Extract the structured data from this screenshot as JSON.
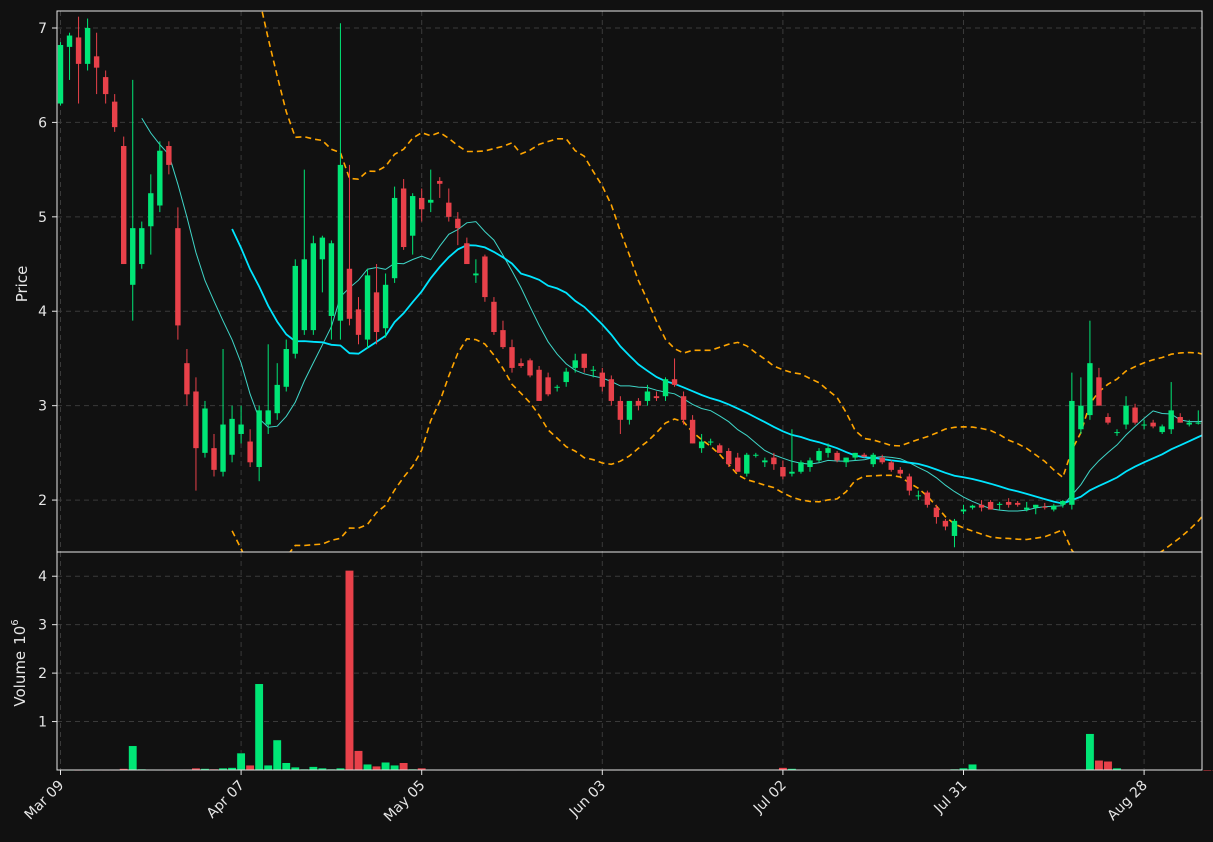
{
  "chart_data": {
    "type": "candlestick",
    "colors": {
      "background": "#111111",
      "up": "#00e676",
      "down": "#e8414a",
      "ma_fast": "#3fd6c8",
      "ma_slow": "#00e5ff",
      "bands": "#ffa500",
      "grid": "#3a3a3a",
      "frame": "#e6e6e6"
    },
    "price_panel": {
      "ylabel": "Price",
      "ylim": [
        1.45,
        7.18
      ],
      "yticks": [
        2,
        3,
        4,
        5,
        6,
        7
      ]
    },
    "volume_panel": {
      "ylabel": "Volume",
      "ylabel_exponent": "10",
      "ylabel_power": "6",
      "ylim": [
        0,
        4.5
      ],
      "yticks": [
        1,
        2,
        3,
        4
      ]
    },
    "x_ticks": [
      {
        "i": 0,
        "label": "Mar 09"
      },
      {
        "i": 20,
        "label": "Apr 07"
      },
      {
        "i": 40,
        "label": "May 05"
      },
      {
        "i": 60,
        "label": "Jun 03"
      },
      {
        "i": 80,
        "label": "Jul 02"
      },
      {
        "i": 100,
        "label": "Jul 31"
      },
      {
        "i": 120,
        "label": "Aug 28"
      }
    ],
    "candles": [
      [
        6.2,
        6.85,
        6.18,
        6.82
      ],
      [
        6.8,
        6.95,
        6.45,
        6.92
      ],
      [
        6.9,
        7.12,
        6.2,
        6.62
      ],
      [
        6.62,
        7.1,
        6.55,
        7.0
      ],
      [
        6.7,
        6.95,
        6.3,
        6.58
      ],
      [
        6.48,
        6.55,
        6.2,
        6.3
      ],
      [
        6.22,
        6.3,
        5.9,
        5.95
      ],
      [
        5.75,
        5.85,
        4.5,
        4.5
      ],
      [
        4.28,
        6.45,
        3.9,
        4.88
      ],
      [
        4.5,
        4.95,
        4.45,
        4.88
      ],
      [
        4.9,
        5.45,
        4.6,
        5.25
      ],
      [
        5.12,
        5.8,
        5.05,
        5.7
      ],
      [
        5.75,
        5.8,
        5.45,
        5.55
      ],
      [
        4.88,
        5.1,
        3.7,
        3.85
      ],
      [
        3.45,
        3.6,
        3.0,
        3.12
      ],
      [
        3.15,
        3.3,
        2.1,
        2.55
      ],
      [
        2.5,
        3.05,
        2.45,
        2.97
      ],
      [
        2.55,
        2.7,
        2.25,
        2.32
      ],
      [
        2.3,
        3.6,
        2.25,
        2.8
      ],
      [
        2.48,
        3.0,
        2.4,
        2.86
      ],
      [
        2.7,
        3.0,
        2.6,
        2.8
      ],
      [
        2.62,
        2.75,
        2.35,
        2.4
      ],
      [
        2.35,
        3.0,
        2.2,
        2.95
      ],
      [
        2.8,
        3.65,
        2.7,
        2.95
      ],
      [
        2.92,
        3.45,
        2.85,
        3.22
      ],
      [
        3.2,
        3.7,
        3.15,
        3.6
      ],
      [
        3.55,
        4.55,
        3.5,
        4.48
      ],
      [
        3.8,
        5.5,
        3.75,
        4.55
      ],
      [
        3.8,
        4.8,
        3.75,
        4.72
      ],
      [
        4.55,
        4.8,
        4.2,
        4.78
      ],
      [
        3.95,
        4.75,
        3.7,
        4.72
      ],
      [
        3.9,
        7.05,
        3.7,
        5.55
      ],
      [
        4.45,
        5.55,
        3.85,
        3.92
      ],
      [
        4.02,
        4.15,
        3.65,
        3.75
      ],
      [
        3.7,
        4.45,
        3.6,
        4.38
      ],
      [
        4.2,
        4.5,
        3.65,
        3.78
      ],
      [
        3.82,
        4.4,
        3.72,
        4.28
      ],
      [
        4.35,
        5.32,
        4.3,
        5.2
      ],
      [
        5.3,
        5.4,
        4.65,
        4.68
      ],
      [
        4.8,
        5.25,
        4.6,
        5.22
      ],
      [
        5.2,
        5.3,
        4.95,
        5.08
      ],
      [
        5.15,
        5.5,
        5.05,
        5.18
      ],
      [
        5.38,
        5.42,
        5.2,
        5.35
      ],
      [
        5.15,
        5.3,
        4.95,
        5.0
      ],
      [
        4.98,
        5.05,
        4.7,
        4.88
      ],
      [
        4.72,
        4.78,
        4.5,
        4.5
      ],
      [
        4.38,
        4.55,
        4.3,
        4.4
      ],
      [
        4.58,
        4.6,
        4.1,
        4.15
      ],
      [
        4.1,
        4.15,
        3.75,
        3.78
      ],
      [
        3.8,
        3.9,
        3.6,
        3.62
      ],
      [
        3.62,
        3.7,
        3.35,
        3.4
      ],
      [
        3.45,
        3.5,
        3.4,
        3.42
      ],
      [
        3.48,
        3.5,
        3.3,
        3.32
      ],
      [
        3.38,
        3.42,
        3.05,
        3.05
      ],
      [
        3.3,
        3.35,
        3.1,
        3.12
      ],
      [
        3.2,
        3.22,
        3.15,
        3.2
      ],
      [
        3.25,
        3.4,
        3.2,
        3.36
      ],
      [
        3.4,
        3.55,
        3.35,
        3.48
      ],
      [
        3.55,
        3.55,
        3.35,
        3.4
      ],
      [
        3.38,
        3.42,
        3.3,
        3.38
      ],
      [
        3.35,
        3.4,
        3.15,
        3.2
      ],
      [
        3.28,
        3.32,
        3.0,
        3.05
      ],
      [
        3.05,
        3.1,
        2.7,
        2.85
      ],
      [
        2.85,
        3.05,
        2.8,
        3.05
      ],
      [
        3.05,
        3.08,
        2.95,
        3.0
      ],
      [
        3.05,
        3.22,
        3.0,
        3.15
      ],
      [
        3.1,
        3.15,
        3.05,
        3.08
      ],
      [
        3.1,
        3.3,
        3.05,
        3.28
      ],
      [
        3.28,
        3.5,
        3.2,
        3.22
      ],
      [
        3.1,
        3.15,
        2.8,
        2.85
      ],
      [
        2.85,
        2.9,
        2.6,
        2.6
      ],
      [
        2.55,
        2.7,
        2.5,
        2.62
      ],
      [
        2.62,
        2.65,
        2.58,
        2.62
      ],
      [
        2.58,
        2.6,
        2.5,
        2.5
      ],
      [
        2.52,
        2.55,
        2.35,
        2.38
      ],
      [
        2.45,
        2.5,
        2.3,
        2.3
      ],
      [
        2.28,
        2.5,
        2.25,
        2.48
      ],
      [
        2.48,
        2.5,
        2.45,
        2.48
      ],
      [
        2.4,
        2.45,
        2.35,
        2.42
      ],
      [
        2.45,
        2.5,
        2.32,
        2.38
      ],
      [
        2.35,
        2.42,
        2.22,
        2.25
      ],
      [
        2.28,
        2.75,
        2.25,
        2.3
      ],
      [
        2.3,
        2.42,
        2.28,
        2.4
      ],
      [
        2.35,
        2.45,
        2.3,
        2.42
      ],
      [
        2.42,
        2.55,
        2.4,
        2.52
      ],
      [
        2.5,
        2.6,
        2.45,
        2.55
      ],
      [
        2.5,
        2.52,
        2.4,
        2.42
      ],
      [
        2.4,
        2.45,
        2.35,
        2.45
      ],
      [
        2.45,
        2.5,
        2.42,
        2.5
      ],
      [
        2.48,
        2.5,
        2.45,
        2.46
      ],
      [
        2.38,
        2.5,
        2.35,
        2.48
      ],
      [
        2.45,
        2.48,
        2.38,
        2.4
      ],
      [
        2.4,
        2.42,
        2.3,
        2.32
      ],
      [
        2.32,
        2.35,
        2.25,
        2.28
      ],
      [
        2.25,
        2.28,
        2.05,
        2.1
      ],
      [
        2.05,
        2.1,
        2.0,
        2.05
      ],
      [
        2.08,
        2.1,
        1.92,
        1.95
      ],
      [
        1.92,
        1.95,
        1.75,
        1.82
      ],
      [
        1.78,
        1.8,
        1.68,
        1.72
      ],
      [
        1.62,
        1.8,
        1.5,
        1.78
      ],
      [
        1.88,
        1.95,
        1.85,
        1.9
      ],
      [
        1.92,
        1.95,
        1.9,
        1.94
      ],
      [
        1.95,
        2.0,
        1.88,
        1.92
      ],
      [
        1.98,
        2.0,
        1.9,
        1.9
      ],
      [
        1.95,
        1.98,
        1.9,
        1.96
      ],
      [
        1.98,
        2.02,
        1.92,
        1.95
      ],
      [
        1.97,
        1.99,
        1.93,
        1.95
      ],
      [
        1.9,
        1.98,
        1.88,
        1.92
      ],
      [
        1.92,
        1.95,
        1.85,
        1.95
      ],
      [
        1.93,
        1.97,
        1.9,
        1.92
      ],
      [
        1.9,
        1.96,
        1.88,
        1.94
      ],
      [
        1.95,
        2.0,
        1.92,
        1.99
      ],
      [
        1.95,
        3.35,
        1.9,
        3.05
      ],
      [
        2.75,
        3.3,
        2.7,
        3.0
      ],
      [
        2.9,
        3.9,
        2.85,
        3.45
      ],
      [
        3.3,
        3.4,
        3.0,
        3.0
      ],
      [
        2.88,
        2.92,
        2.8,
        2.82
      ],
      [
        2.72,
        2.75,
        2.68,
        2.72
      ],
      [
        2.8,
        3.1,
        2.75,
        3.0
      ],
      [
        2.98,
        3.02,
        2.8,
        2.82
      ],
      [
        2.8,
        2.85,
        2.75,
        2.8
      ],
      [
        2.82,
        2.85,
        2.76,
        2.78
      ],
      [
        2.72,
        2.8,
        2.7,
        2.78
      ],
      [
        2.75,
        3.25,
        2.7,
        2.95
      ],
      [
        2.88,
        2.92,
        2.82,
        2.82
      ],
      [
        2.8,
        2.85,
        2.78,
        2.82
      ],
      [
        2.82,
        2.95,
        2.8,
        2.82
      ],
      [
        2.84,
        2.88,
        2.78,
        2.8
      ],
      [
        2.82,
        2.95,
        2.72,
        2.72
      ]
    ],
    "volume": [
      0.005,
      0.004,
      0.003,
      0.004,
      0.004,
      0.004,
      0.004,
      0.03,
      0.5,
      0.02,
      0.015,
      0.01,
      0.008,
      0.01,
      0.012,
      0.04,
      0.03,
      0.02,
      0.04,
      0.05,
      0.35,
      0.1,
      1.78,
      0.1,
      0.62,
      0.15,
      0.06,
      0.02,
      0.07,
      0.04,
      0.02,
      0.04,
      4.12,
      0.4,
      0.12,
      0.08,
      0.16,
      0.1,
      0.15,
      0.02,
      0.04,
      0.015,
      0.01,
      0.01,
      0.01,
      0.01,
      0.005,
      0.005,
      0.005,
      0.005,
      0.01,
      0.005,
      0.01,
      0.005,
      0.005,
      0.005,
      0.005,
      0.01,
      0.005,
      0.005,
      0.005,
      0.01,
      0.005,
      0.01,
      0.005,
      0.005,
      0.01,
      0.005,
      0.01,
      0.005,
      0.005,
      0.005,
      0.005,
      0.005,
      0.01,
      0.005,
      0.005,
      0.005,
      0.005,
      0.01,
      0.05,
      0.03,
      0.01,
      0.005,
      0.005,
      0.005,
      0.01,
      0.005,
      0.005,
      0.005,
      0.005,
      0.005,
      0.005,
      0.005,
      0.005,
      0.005,
      0.005,
      0.01,
      0.005,
      0.02,
      0.04,
      0.12,
      0.01,
      0.005,
      0.01,
      0.01,
      0.005,
      0.005,
      0.005,
      0.005,
      0.005,
      0.005,
      0.005,
      0.005,
      0.75,
      0.2,
      0.18,
      0.04,
      0.01,
      0.01,
      0.01,
      0.005,
      0.01,
      0.005,
      0.01,
      0.01,
      0.01,
      0.005,
      0.005,
      0.01,
      0.01,
      0.005,
      0.005
    ]
  }
}
